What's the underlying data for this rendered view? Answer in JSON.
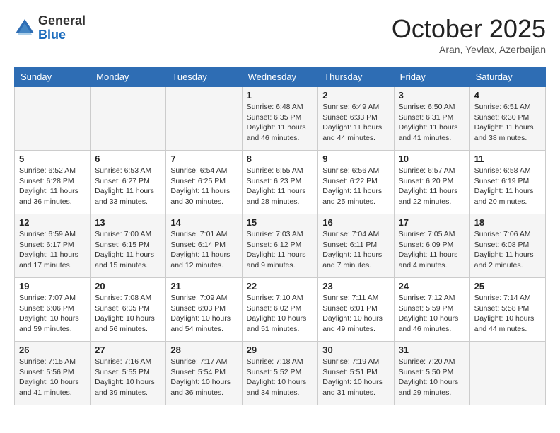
{
  "header": {
    "logo_general": "General",
    "logo_blue": "Blue",
    "month": "October 2025",
    "location": "Aran, Yevlax, Azerbaijan"
  },
  "weekdays": [
    "Sunday",
    "Monday",
    "Tuesday",
    "Wednesday",
    "Thursday",
    "Friday",
    "Saturday"
  ],
  "weeks": [
    [
      null,
      null,
      null,
      {
        "day": 1,
        "sunrise": "6:48 AM",
        "sunset": "6:35 PM",
        "daylight": "11 hours and 46 minutes."
      },
      {
        "day": 2,
        "sunrise": "6:49 AM",
        "sunset": "6:33 PM",
        "daylight": "11 hours and 44 minutes."
      },
      {
        "day": 3,
        "sunrise": "6:50 AM",
        "sunset": "6:31 PM",
        "daylight": "11 hours and 41 minutes."
      },
      {
        "day": 4,
        "sunrise": "6:51 AM",
        "sunset": "6:30 PM",
        "daylight": "11 hours and 38 minutes."
      }
    ],
    [
      {
        "day": 5,
        "sunrise": "6:52 AM",
        "sunset": "6:28 PM",
        "daylight": "11 hours and 36 minutes."
      },
      {
        "day": 6,
        "sunrise": "6:53 AM",
        "sunset": "6:27 PM",
        "daylight": "11 hours and 33 minutes."
      },
      {
        "day": 7,
        "sunrise": "6:54 AM",
        "sunset": "6:25 PM",
        "daylight": "11 hours and 30 minutes."
      },
      {
        "day": 8,
        "sunrise": "6:55 AM",
        "sunset": "6:23 PM",
        "daylight": "11 hours and 28 minutes."
      },
      {
        "day": 9,
        "sunrise": "6:56 AM",
        "sunset": "6:22 PM",
        "daylight": "11 hours and 25 minutes."
      },
      {
        "day": 10,
        "sunrise": "6:57 AM",
        "sunset": "6:20 PM",
        "daylight": "11 hours and 22 minutes."
      },
      {
        "day": 11,
        "sunrise": "6:58 AM",
        "sunset": "6:19 PM",
        "daylight": "11 hours and 20 minutes."
      }
    ],
    [
      {
        "day": 12,
        "sunrise": "6:59 AM",
        "sunset": "6:17 PM",
        "daylight": "11 hours and 17 minutes."
      },
      {
        "day": 13,
        "sunrise": "7:00 AM",
        "sunset": "6:15 PM",
        "daylight": "11 hours and 15 minutes."
      },
      {
        "day": 14,
        "sunrise": "7:01 AM",
        "sunset": "6:14 PM",
        "daylight": "11 hours and 12 minutes."
      },
      {
        "day": 15,
        "sunrise": "7:03 AM",
        "sunset": "6:12 PM",
        "daylight": "11 hours and 9 minutes."
      },
      {
        "day": 16,
        "sunrise": "7:04 AM",
        "sunset": "6:11 PM",
        "daylight": "11 hours and 7 minutes."
      },
      {
        "day": 17,
        "sunrise": "7:05 AM",
        "sunset": "6:09 PM",
        "daylight": "11 hours and 4 minutes."
      },
      {
        "day": 18,
        "sunrise": "7:06 AM",
        "sunset": "6:08 PM",
        "daylight": "11 hours and 2 minutes."
      }
    ],
    [
      {
        "day": 19,
        "sunrise": "7:07 AM",
        "sunset": "6:06 PM",
        "daylight": "10 hours and 59 minutes."
      },
      {
        "day": 20,
        "sunrise": "7:08 AM",
        "sunset": "6:05 PM",
        "daylight": "10 hours and 56 minutes."
      },
      {
        "day": 21,
        "sunrise": "7:09 AM",
        "sunset": "6:03 PM",
        "daylight": "10 hours and 54 minutes."
      },
      {
        "day": 22,
        "sunrise": "7:10 AM",
        "sunset": "6:02 PM",
        "daylight": "10 hours and 51 minutes."
      },
      {
        "day": 23,
        "sunrise": "7:11 AM",
        "sunset": "6:01 PM",
        "daylight": "10 hours and 49 minutes."
      },
      {
        "day": 24,
        "sunrise": "7:12 AM",
        "sunset": "5:59 PM",
        "daylight": "10 hours and 46 minutes."
      },
      {
        "day": 25,
        "sunrise": "7:14 AM",
        "sunset": "5:58 PM",
        "daylight": "10 hours and 44 minutes."
      }
    ],
    [
      {
        "day": 26,
        "sunrise": "7:15 AM",
        "sunset": "5:56 PM",
        "daylight": "10 hours and 41 minutes."
      },
      {
        "day": 27,
        "sunrise": "7:16 AM",
        "sunset": "5:55 PM",
        "daylight": "10 hours and 39 minutes."
      },
      {
        "day": 28,
        "sunrise": "7:17 AM",
        "sunset": "5:54 PM",
        "daylight": "10 hours and 36 minutes."
      },
      {
        "day": 29,
        "sunrise": "7:18 AM",
        "sunset": "5:52 PM",
        "daylight": "10 hours and 34 minutes."
      },
      {
        "day": 30,
        "sunrise": "7:19 AM",
        "sunset": "5:51 PM",
        "daylight": "10 hours and 31 minutes."
      },
      {
        "day": 31,
        "sunrise": "7:20 AM",
        "sunset": "5:50 PM",
        "daylight": "10 hours and 29 minutes."
      },
      null
    ]
  ],
  "labels": {
    "sunrise": "Sunrise:",
    "sunset": "Sunset:",
    "daylight": "Daylight:"
  }
}
